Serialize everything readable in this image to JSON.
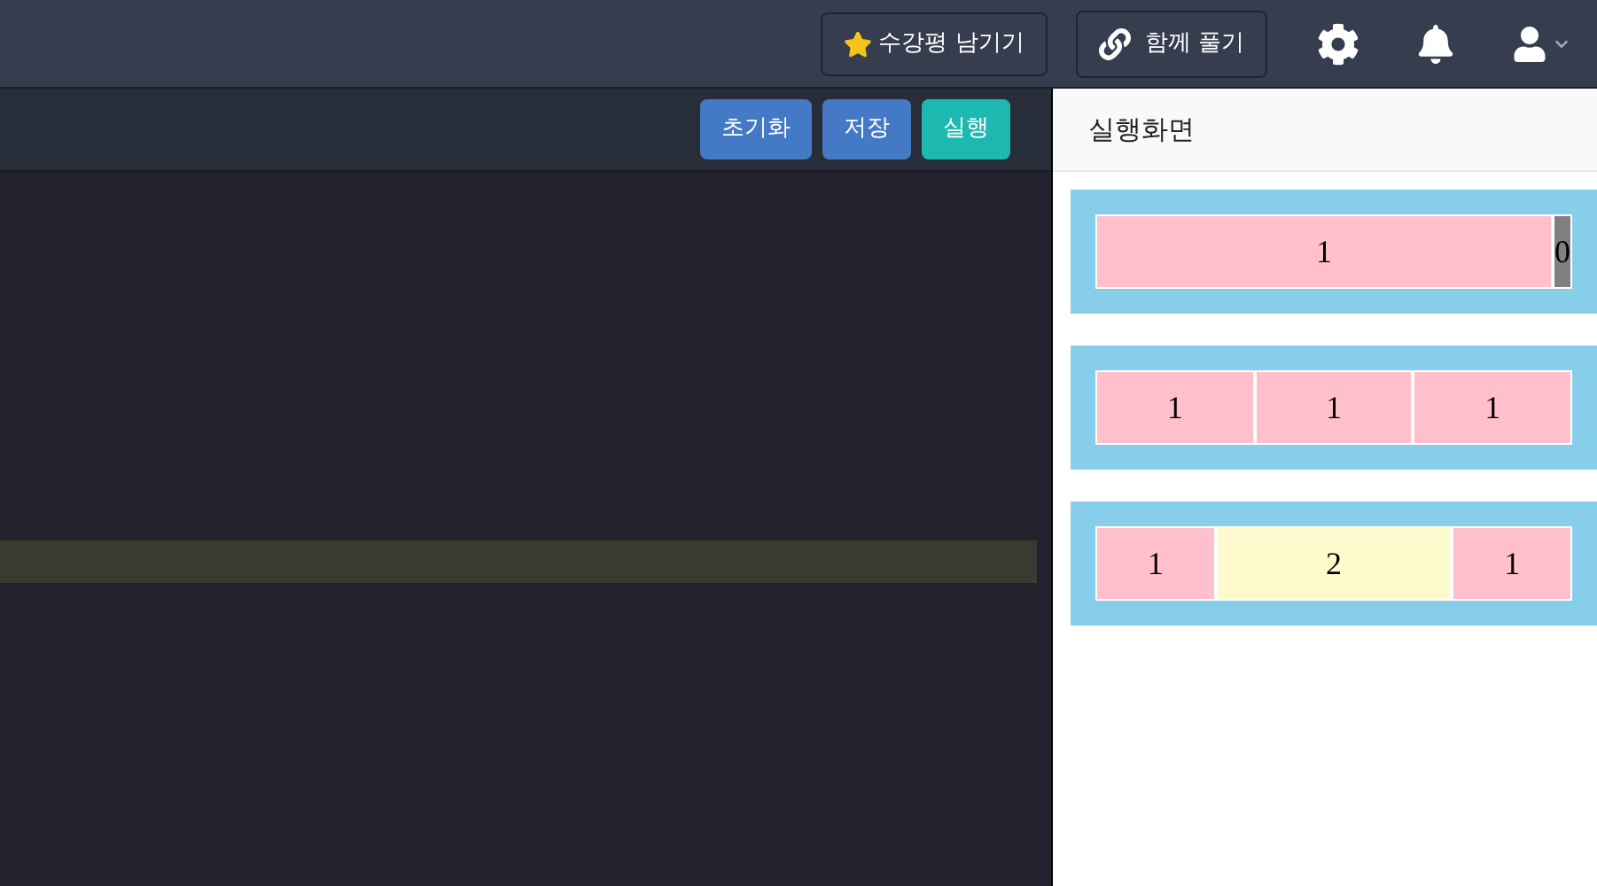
{
  "header": {
    "review_button": "수강평 남기기",
    "together_button": "함께 풀기"
  },
  "toolbar": {
    "buttons": [
      {
        "label": "초기화",
        "kind": "secondary"
      },
      {
        "label": "저장",
        "kind": "secondary"
      },
      {
        "label": "실행",
        "kind": "primary"
      }
    ]
  },
  "editor": {
    "highlighted_line": true
  },
  "preview": {
    "title": "실행화면",
    "containers": [
      {
        "items": [
          {
            "text": "1",
            "color": "#ffc0cb"
          },
          {
            "text": "0",
            "color": "#808080"
          }
        ]
      },
      {
        "items": [
          {
            "text": "1",
            "color": "#ffc0cb"
          },
          {
            "text": "1",
            "color": "#ffc0cb"
          },
          {
            "text": "1",
            "color": "#ffc0cb"
          }
        ]
      },
      {
        "items": [
          {
            "text": "1",
            "color": "#ffc0cb"
          },
          {
            "text": "2",
            "color": "#fffacd"
          },
          {
            "text": "1",
            "color": "#ffc0cb"
          }
        ]
      }
    ]
  }
}
